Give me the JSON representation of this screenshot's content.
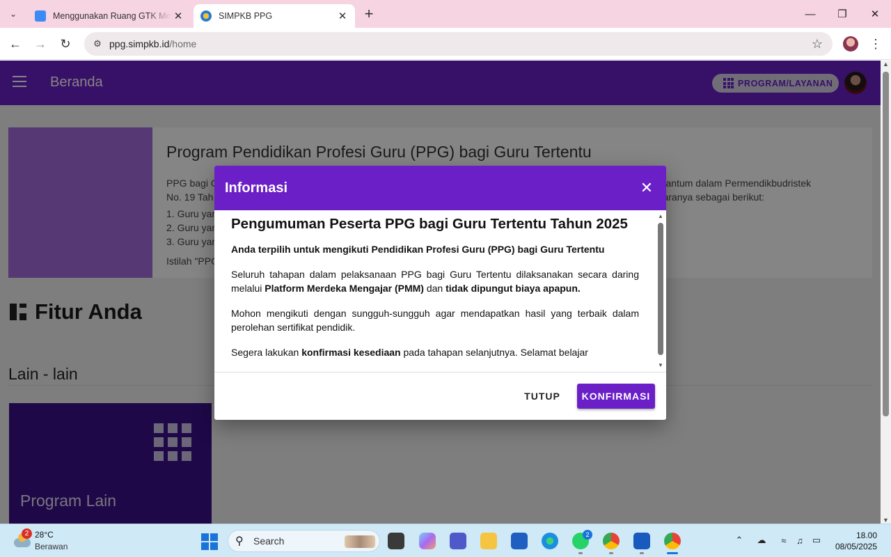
{
  "browser": {
    "tabs": [
      {
        "title": "Menggunakan Ruang GTK Mela",
        "active": false
      },
      {
        "title": "SIMPKB PPG",
        "active": true
      }
    ],
    "url_host": "ppg.simpkb.id",
    "url_path": "/home"
  },
  "appbar": {
    "title": "Beranda",
    "program_button": "PROGRAM/LAYANAN"
  },
  "banner": {
    "title": "Program Pendidikan Profesi Guru (PPG) bagi Guru Tertentu",
    "line1_start": "PPG bagi G",
    "line1_end": "na tercantum dalam Permendikbudristek",
    "line2_start": "No. 19 Tah",
    "line2_end": "aranya sebagai berikut:",
    "item1": "1. Guru yar",
    "item2": "2. Guru yar",
    "item3": "3. Guru yar",
    "note": "Istilah \"PPG"
  },
  "fitur": {
    "title": "Fitur Anda"
  },
  "lain": {
    "title": "Lain - lain"
  },
  "program_card": {
    "title": "Program Lain"
  },
  "dialog": {
    "title": "Informasi",
    "heading": "Pengumuman Peserta PPG bagi Guru Tertentu Tahun 2025",
    "subheading": "Anda terpilih untuk mengikuti Pendidikan Profesi Guru (PPG) bagi Guru Tertentu",
    "p1_a": "Seluruh tahapan dalam pelaksanaan PPG bagi Guru Tertentu dilaksanakan secara daring melalui ",
    "p1_b": "Platform Merdeka Mengajar (PMM)",
    "p1_c": " dan ",
    "p1_d": "tidak dipungut biaya apapun.",
    "p2": "Mohon mengikuti dengan sungguh-sungguh agar mendapatkan hasil yang terbaik dalam perolehan sertifikat pendidik.",
    "p3_a": "Segera lakukan ",
    "p3_b": "konfirmasi kesediaan",
    "p3_c": " pada tahapan selanjutnya. Selamat belajar",
    "btn_close": "TUTUP",
    "btn_confirm": "KONFIRMASI"
  },
  "taskbar": {
    "weather_badge": "2",
    "temperature": "28°C",
    "condition": "Berawan",
    "search_label": "Search",
    "whatsapp_badge": "2",
    "time": "18.00",
    "date": "08/05/2025"
  },
  "colors": {
    "brand_purple": "#6a1fc7",
    "tab_strip": "#f6d4e2",
    "taskbar": "#cfe9f7"
  }
}
